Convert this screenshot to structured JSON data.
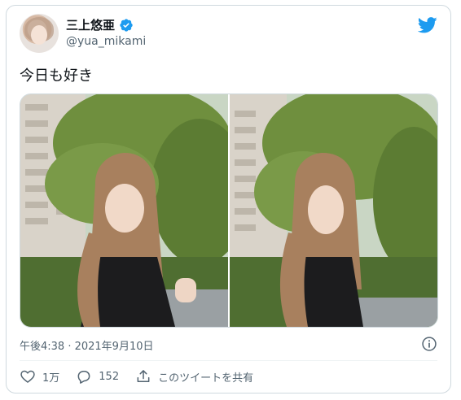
{
  "author": {
    "name": "三上悠亜",
    "handle": "@yua_mikami"
  },
  "tweet": {
    "text": "今日も好き",
    "timestamp": "午後4:38 · 2021年9月10日"
  },
  "actions": {
    "likes": "1万",
    "replies": "152",
    "share_label": "このツイートを共有"
  },
  "colors": {
    "brand": "#1d9bf0",
    "border": "#cfd9de",
    "secondary_text": "#536471"
  },
  "icons": {
    "brand": "twitter-bird-icon",
    "verified": "verified-badge-icon",
    "info": "info-icon",
    "like": "heart-icon",
    "reply": "reply-bubble-icon",
    "share": "share-icon"
  }
}
